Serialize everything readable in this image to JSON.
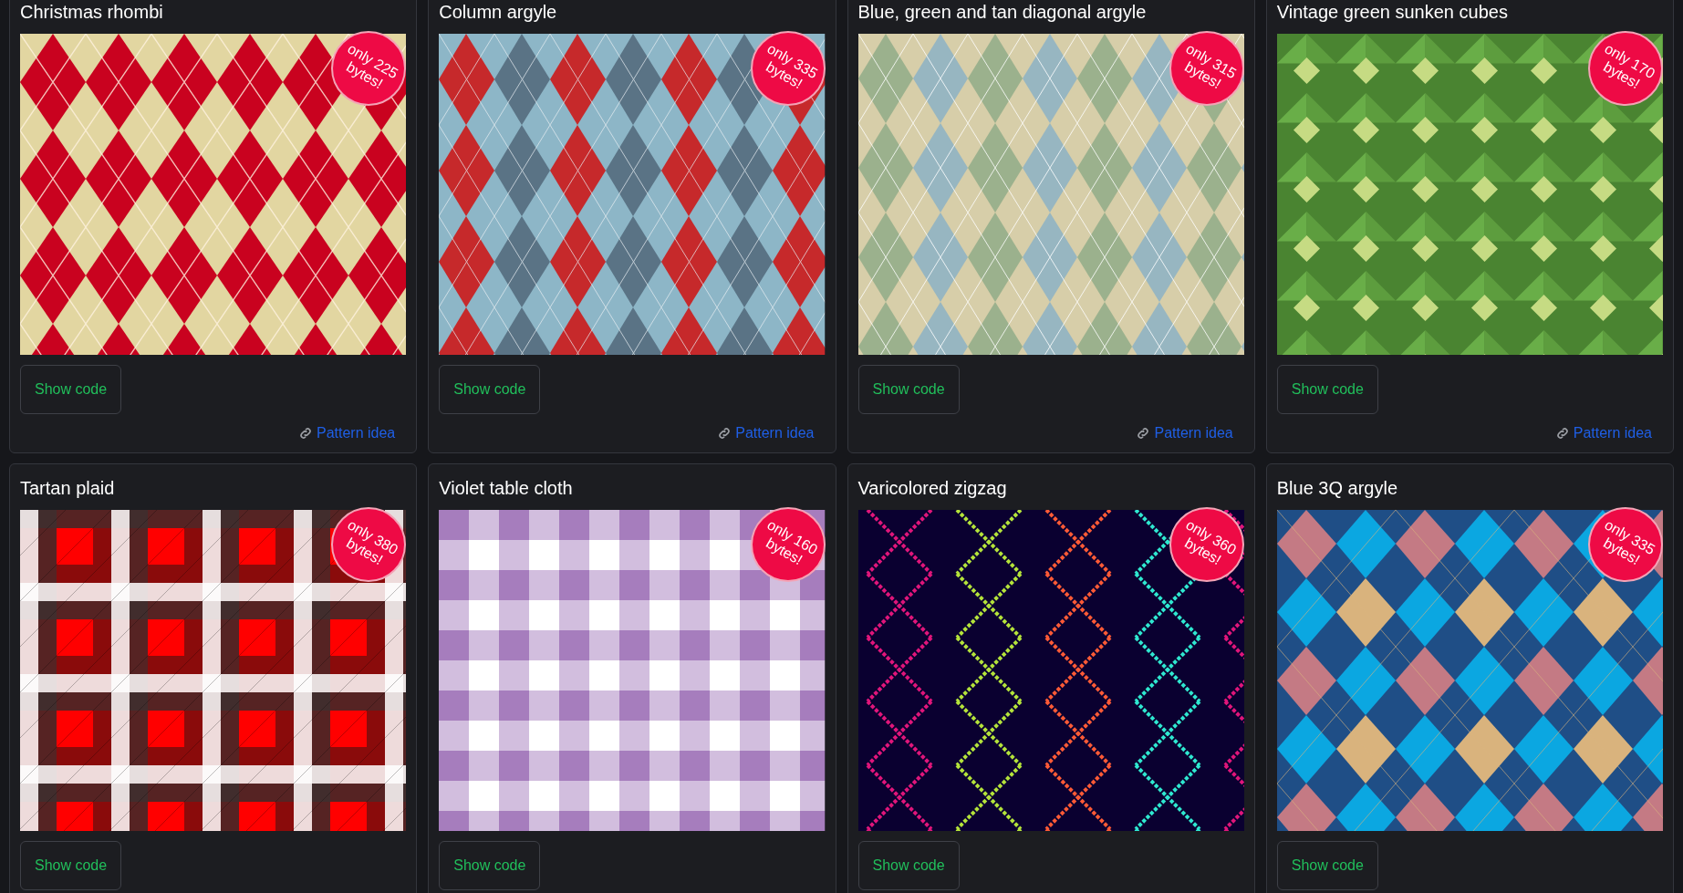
{
  "cards": [
    {
      "title": "Christmas rhombi",
      "kind": "rhombi",
      "badge": "only 225 bytes!",
      "button": "Show code",
      "link": "Pattern idea"
    },
    {
      "title": "Column argyle",
      "kind": "column",
      "badge": "only 335 bytes!",
      "button": "Show code",
      "link": "Pattern idea"
    },
    {
      "title": "Blue, green and tan diagonal argyle",
      "kind": "diagonal",
      "badge": "only 315 bytes!",
      "button": "Show code",
      "link": "Pattern idea"
    },
    {
      "title": "Vintage green sunken cubes",
      "kind": "cubes",
      "badge": "only 170 bytes!",
      "button": "Show code",
      "link": "Pattern idea"
    },
    {
      "title": "Tartan plaid",
      "kind": "tartan",
      "badge": "only 380 bytes!",
      "button": "Show code"
    },
    {
      "title": "Violet table cloth",
      "kind": "gingham",
      "badge": "only 160 bytes!",
      "button": "Show code"
    },
    {
      "title": "Varicolored zigzag",
      "kind": "zigzag",
      "badge": "only 360 bytes!",
      "button": "Show code"
    },
    {
      "title": "Blue 3Q argyle",
      "kind": "argyle",
      "badge": "only 335 bytes!",
      "button": "Show code"
    }
  ]
}
